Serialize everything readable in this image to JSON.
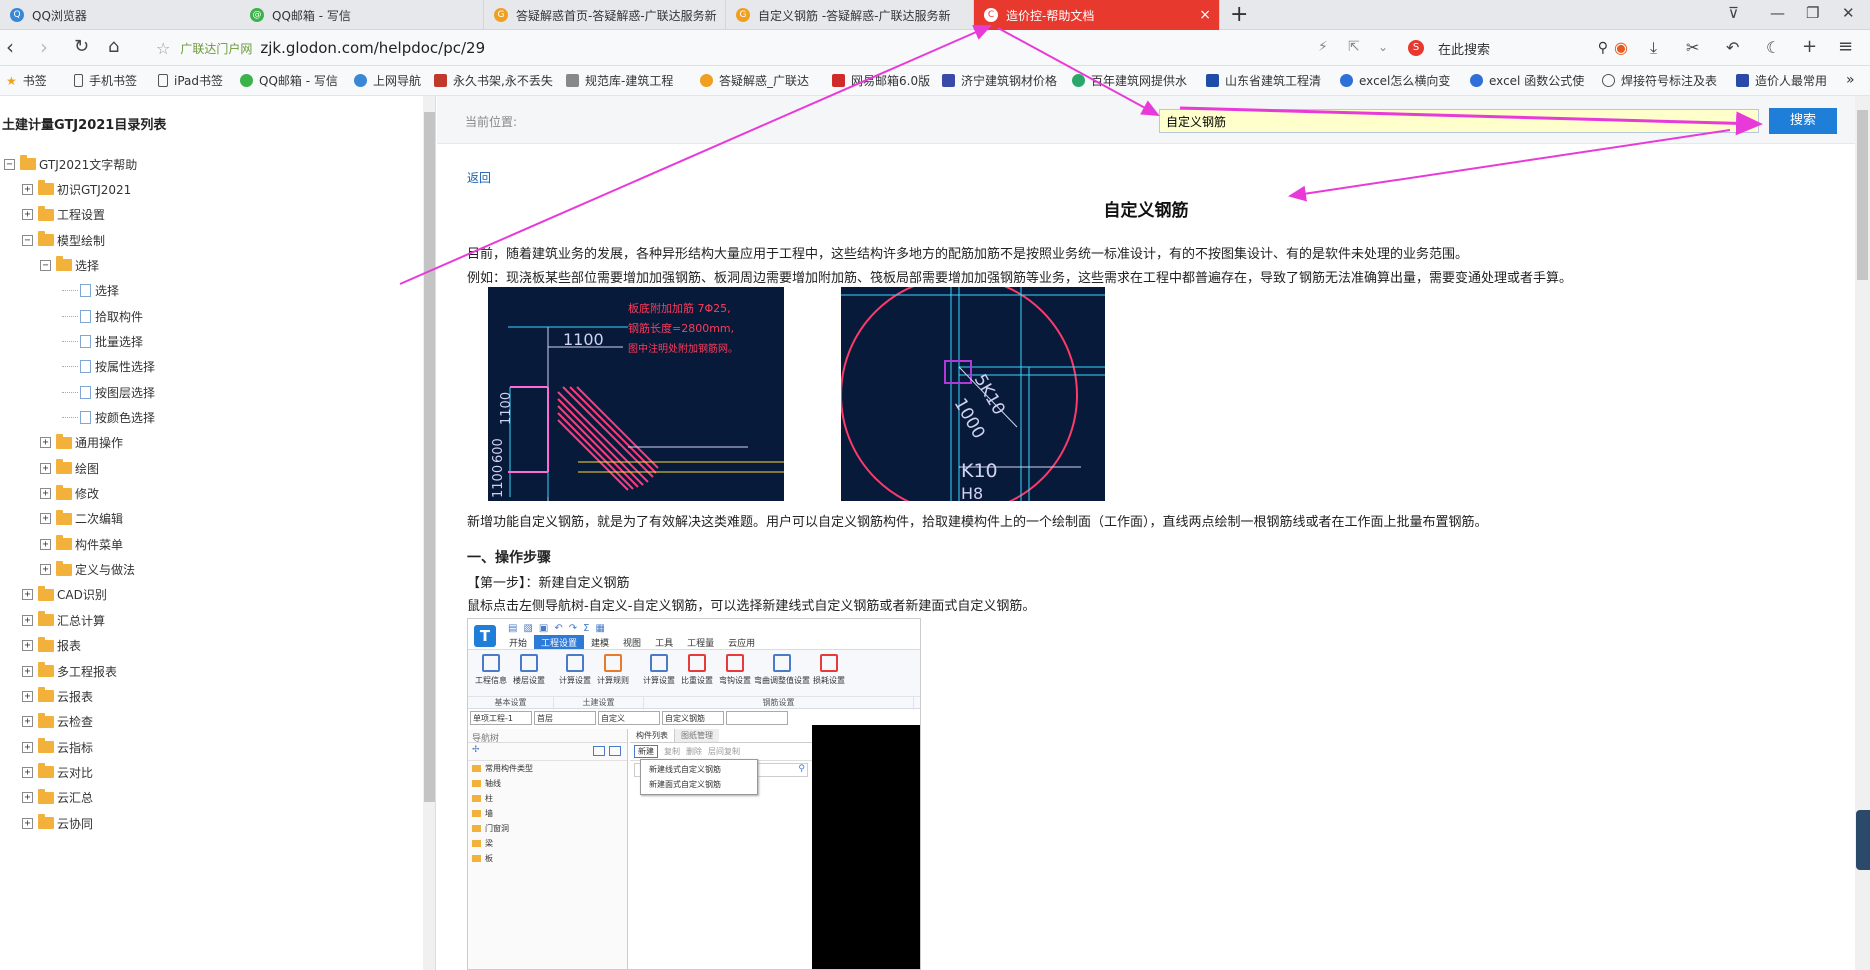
{
  "tabs": [
    {
      "label": "QQ浏览器"
    },
    {
      "label": "QQ邮箱 - 写信"
    },
    {
      "label": "答疑解惑首页-答疑解惑-广联达服务新"
    },
    {
      "label": "自定义钢筋 -答疑解惑-广联达服务新"
    },
    {
      "label": "造价控-帮助文档"
    }
  ],
  "address": {
    "site_label": "广联达门户网",
    "url": "zjk.glodon.com/helpdoc/pc/29",
    "search_placeholder": "在此搜索"
  },
  "bookmarks": [
    "书签",
    "手机书签",
    "iPad书签",
    "QQ邮箱 - 写信",
    "上网导航",
    "永久书架,永不丢失",
    "规范库-建筑工程",
    "答疑解惑_广联达",
    "网易邮箱6.0版",
    "济宁建筑钢材价格",
    "百年建筑网提供水",
    "山东省建筑工程清",
    "excel怎么横向变",
    "excel 函数公式使",
    "焊接符号标注及表",
    "造价人最常用"
  ],
  "sidebar": {
    "title": "土建计量GTJ2021目录列表",
    "tree": [
      {
        "label": "GTJ2021文字帮助",
        "level": 0,
        "type": "folder",
        "toggle": "−"
      },
      {
        "label": "初识GTJ2021",
        "level": 1,
        "type": "folder",
        "toggle": "+"
      },
      {
        "label": "工程设置",
        "level": 1,
        "type": "folder",
        "toggle": "+"
      },
      {
        "label": "模型绘制",
        "level": 1,
        "type": "folder",
        "toggle": "−"
      },
      {
        "label": "选择",
        "level": 2,
        "type": "folder",
        "toggle": "−"
      },
      {
        "label": "选择",
        "level": 3,
        "type": "doc"
      },
      {
        "label": "拾取构件",
        "level": 3,
        "type": "doc"
      },
      {
        "label": "批量选择",
        "level": 3,
        "type": "doc"
      },
      {
        "label": "按属性选择",
        "level": 3,
        "type": "doc"
      },
      {
        "label": "按图层选择",
        "level": 3,
        "type": "doc"
      },
      {
        "label": "按颜色选择",
        "level": 3,
        "type": "doc"
      },
      {
        "label": "通用操作",
        "level": 2,
        "type": "folder",
        "toggle": "+"
      },
      {
        "label": "绘图",
        "level": 2,
        "type": "folder",
        "toggle": "+"
      },
      {
        "label": "修改",
        "level": 2,
        "type": "folder",
        "toggle": "+"
      },
      {
        "label": "二次编辑",
        "level": 2,
        "type": "folder",
        "toggle": "+"
      },
      {
        "label": "构件菜单",
        "level": 2,
        "type": "folder",
        "toggle": "+"
      },
      {
        "label": "定义与做法",
        "level": 2,
        "type": "folder",
        "toggle": "+"
      },
      {
        "label": "CAD识别",
        "level": 1,
        "type": "folder",
        "toggle": "+"
      },
      {
        "label": "汇总计算",
        "level": 1,
        "type": "folder",
        "toggle": "+"
      },
      {
        "label": "报表",
        "level": 1,
        "type": "folder",
        "toggle": "+"
      },
      {
        "label": "多工程报表",
        "level": 1,
        "type": "folder",
        "toggle": "+"
      },
      {
        "label": "云报表",
        "level": 1,
        "type": "folder",
        "toggle": "+"
      },
      {
        "label": "云检查",
        "level": 1,
        "type": "folder",
        "toggle": "+"
      },
      {
        "label": "云指标",
        "level": 1,
        "type": "folder",
        "toggle": "+"
      },
      {
        "label": "云对比",
        "level": 1,
        "type": "folder",
        "toggle": "+"
      },
      {
        "label": "云汇总",
        "level": 1,
        "type": "folder",
        "toggle": "+"
      },
      {
        "label": "云协同",
        "level": 1,
        "type": "folder",
        "toggle": "+"
      }
    ]
  },
  "content": {
    "crumb_label": "当前位置:",
    "search_value": "自定义钢筋",
    "search_button": "搜索",
    "back_link": "返回",
    "title": "自定义钢筋",
    "p1": "目前，随着建筑业务的发展，各种异形结构大量应用于工程中，这些结构许多地方的配筋加筋不是按照业务统一标准设计，有的不按图集设计、有的是软件未处理的业务范围。",
    "p2": "例如：现浇板某些部位需要增加加强钢筋、板洞周边需要增加附加筋、筏板局部需要增加加强钢筋等业务，这些需求在工程中都普遍存在，导致了钢筋无法准确算出量，需要变通处理或者手算。",
    "p3": "新增功能自定义钢筋，就是为了有效解决这类难题。用户可以自定义钢筋构件，拾取建模构件上的一个绘制面（工作面），直线两点绘制一根钢筋线或者在工作面上批量布置钢筋。",
    "section1": "一、操作步骤",
    "step1": "【第一步】：新建自定义钢筋",
    "p4": "鼠标点击左侧导航树-自定义-自定义钢筋，可以选择新建线式自定义钢筋或者新建面式自定义钢筋。",
    "cad1": {
      "labels": [
        "板底附加加筋 7Φ25,",
        "钢筋长度=2800mm,",
        "图中注明处附加钢筋网。"
      ],
      "dim": "1100",
      "v1": "1100",
      "v2": "600",
      "v3": "1100"
    },
    "cad2": {
      "labels": [
        "5K10",
        "1000",
        "K10",
        "H8"
      ]
    },
    "sw": {
      "menu": [
        "开始",
        "工程设置",
        "建模",
        "视图",
        "工具",
        "工程量",
        "云应用"
      ],
      "tools": [
        "工程信息",
        "楼层设置",
        "计算设置",
        "计算规则",
        "计算设置",
        "比重设置",
        "弯钩设置",
        "弯曲调整值设置",
        "损耗设置"
      ],
      "groups": [
        "基本设置",
        "土建设置",
        "钢筋设置"
      ],
      "dropdowns": [
        "单项工程-1",
        "首层",
        "自定义",
        "自定义钢筋"
      ],
      "nav_title": "导航树",
      "list_tabs": [
        "构件列表",
        "图纸管理"
      ],
      "list_btns": [
        "新建",
        "复制",
        "删除",
        "层间复制"
      ],
      "new_menu": [
        "新建线式自定义钢筋",
        "新建面式自定义钢筋"
      ],
      "nav_items": [
        "常用构件类型",
        "轴线",
        "柱",
        "墙",
        "门窗洞",
        "梁",
        "板"
      ]
    }
  }
}
